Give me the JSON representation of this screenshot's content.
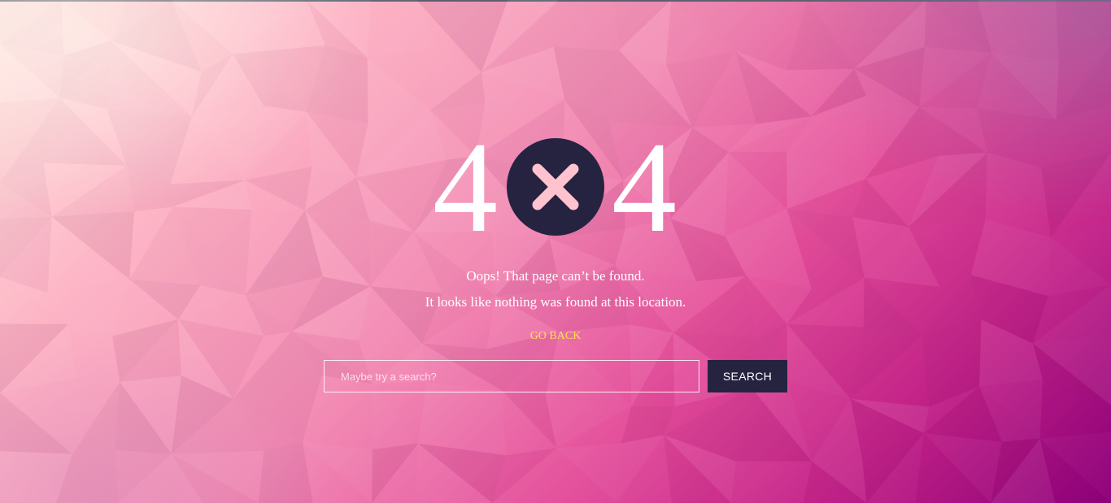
{
  "error": {
    "digit_left": "4",
    "digit_right": "4",
    "middle_icon": "close-x-circle-icon"
  },
  "messages": {
    "line_1": "Oops! That page can’t be found.",
    "line_2": "It looks like nothing was found at this location."
  },
  "links": {
    "go_back": "GO BACK"
  },
  "search": {
    "value": "",
    "placeholder": "Maybe try a search?",
    "button_label": "SEARCH"
  },
  "colors": {
    "circle": "#252340",
    "x_mark": "#ffc2cf",
    "link": "#ffe34f",
    "button_bg": "#252340",
    "text": "#ffffff"
  }
}
